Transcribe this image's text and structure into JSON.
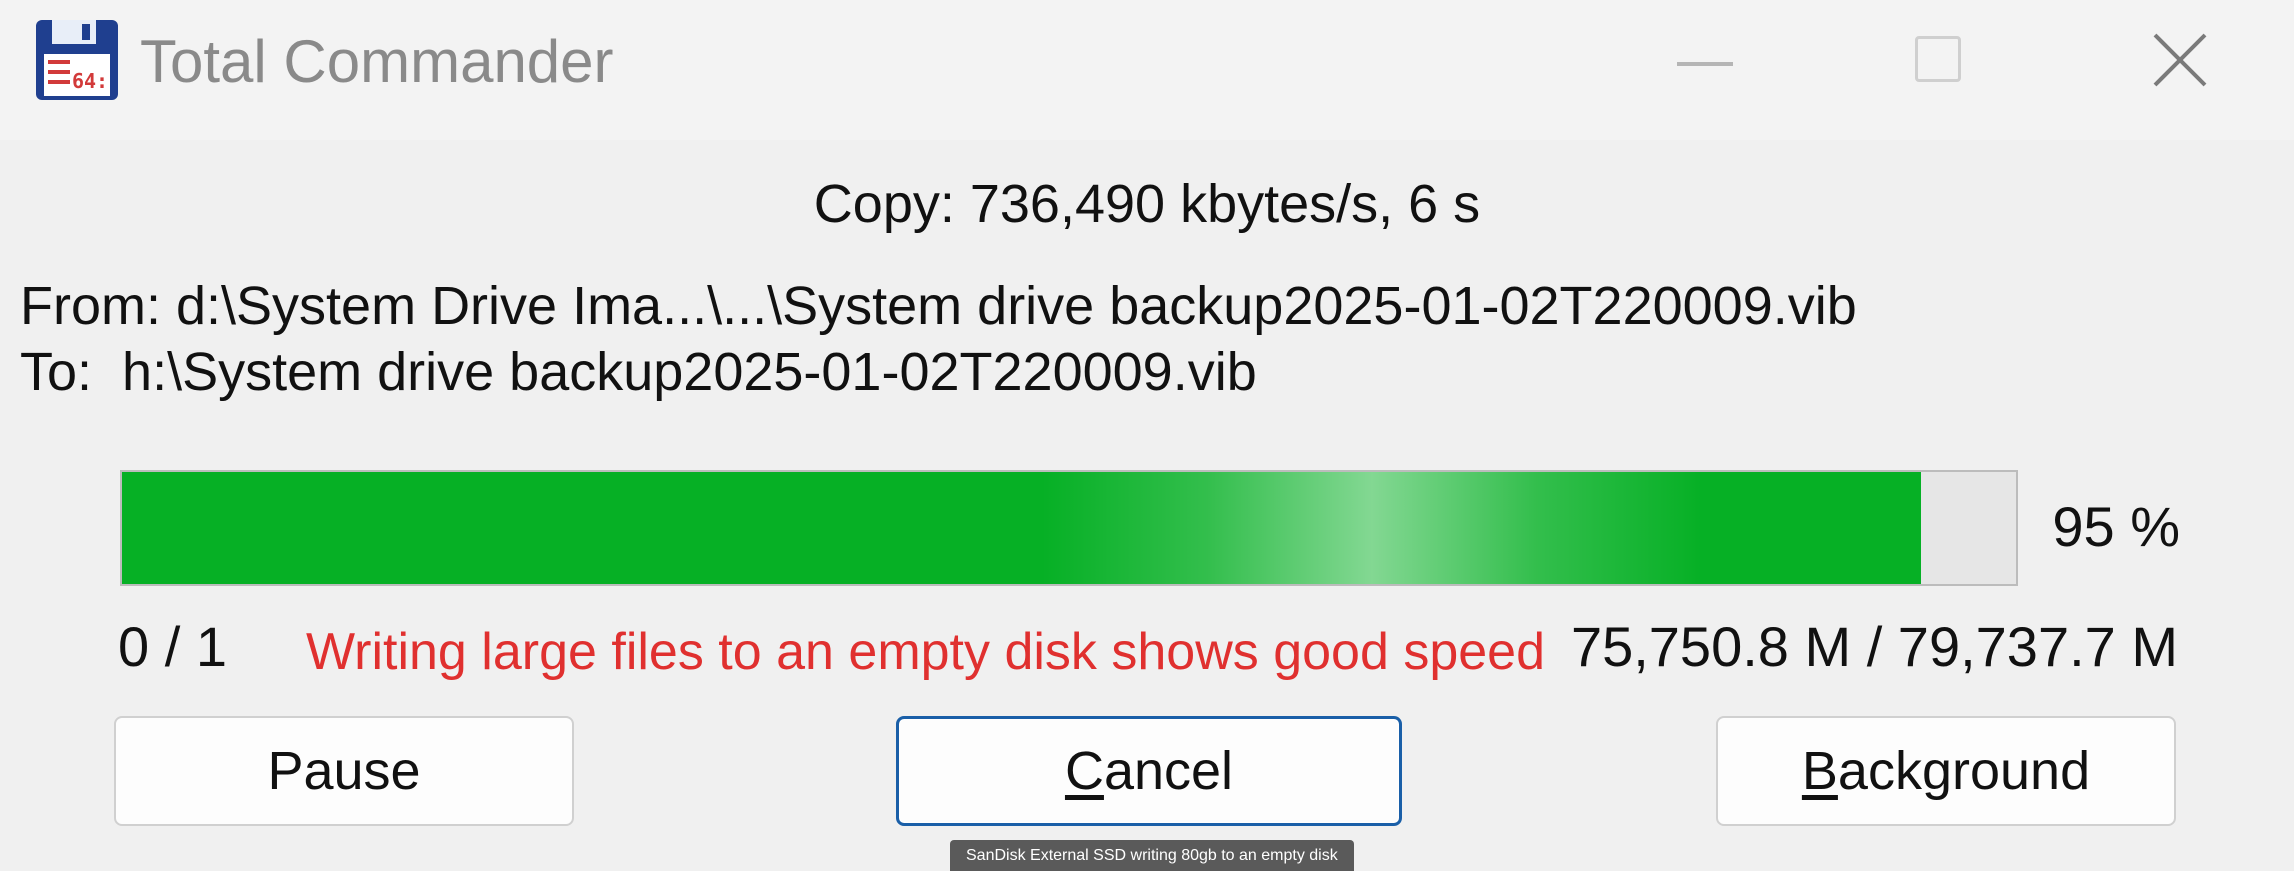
{
  "window": {
    "title": "Total Commander",
    "icon": "floppy-disk-64-icon",
    "controls": [
      "minimize-icon",
      "maximize-icon",
      "close-icon"
    ]
  },
  "copy": {
    "speed_text": "Copy: 736,490 kbytes/s, 6 s",
    "from_text": "From: d:\\System Drive Ima...\\...\\System drive backup2025-01-02T220009.vib",
    "to_text": "To:  h:\\System drive backup2025-01-02T220009.vib"
  },
  "progress": {
    "value": 0.95,
    "percent_text": "95 %",
    "fill_color": "#06b025",
    "file_count_text": "0 / 1",
    "size_text": "75,750.8 M / 79,737.7 M"
  },
  "annotation": {
    "text": "Writing large files to an empty disk shows good speed",
    "color": "#e0302f"
  },
  "buttons": {
    "pause_label": "Pause",
    "cancel_accel": "C",
    "cancel_rest": "ancel",
    "background_accel": "B",
    "background_rest": "ackground"
  },
  "tooltip": {
    "text": "SanDisk External SSD writing 80gb to an empty disk"
  },
  "accent_color": "#1a5fa8"
}
